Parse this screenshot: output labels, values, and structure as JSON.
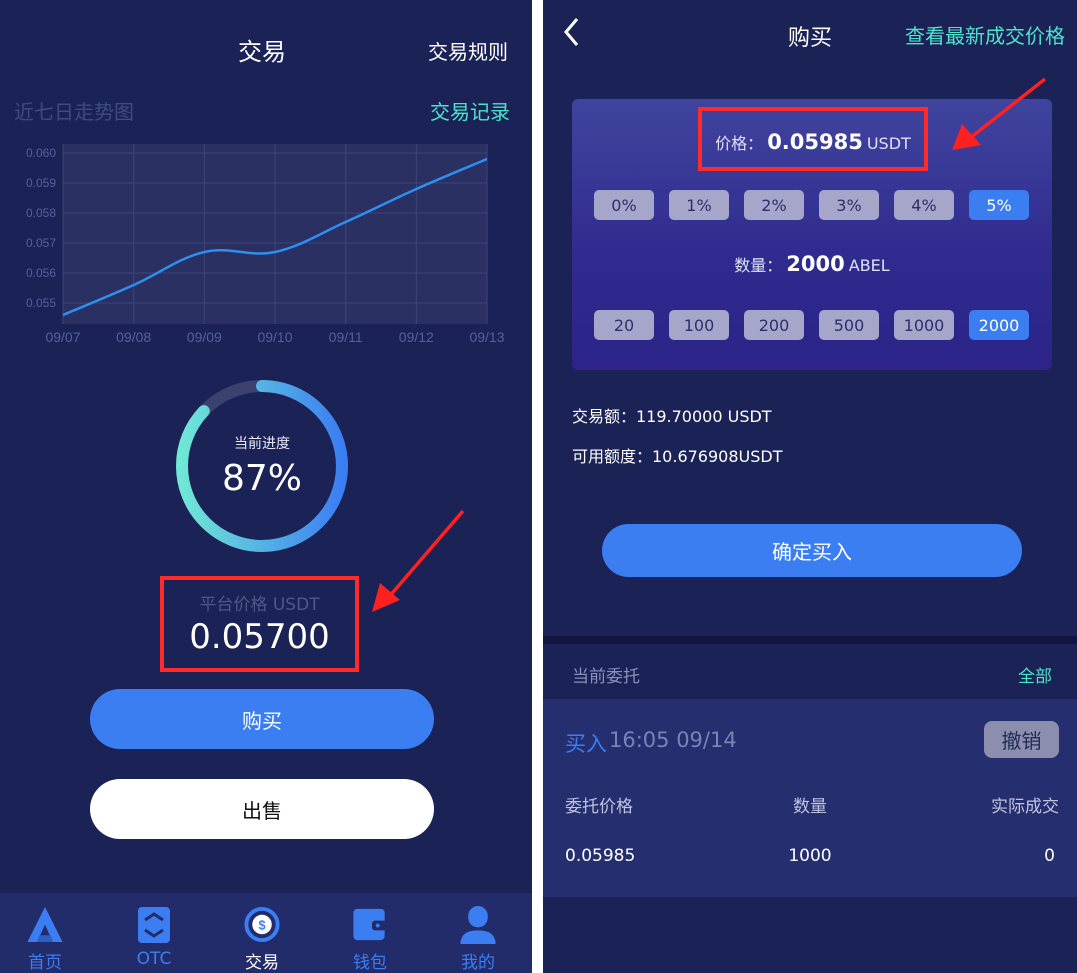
{
  "left": {
    "header": {
      "title": "交易",
      "rules_link": "交易规则"
    },
    "chart_section": {
      "title": "近七日走势图",
      "records_link": "交易记录"
    },
    "chart_data": {
      "type": "line",
      "categories": [
        "09/07",
        "09/08",
        "09/09",
        "09/10",
        "09/11",
        "09/12",
        "09/13"
      ],
      "series": [
        {
          "values": [
            0.0546,
            0.0556,
            0.0567,
            0.0567,
            0.0577,
            0.0588,
            0.0598
          ]
        }
      ],
      "y_ticks": [
        "0.060",
        "0.059",
        "0.058",
        "0.057",
        "0.056",
        "0.055"
      ],
      "ylim": [
        0.0543,
        0.0603
      ],
      "grid": true,
      "line_color": "#2e8ff0"
    },
    "progress": {
      "label": "当前进度",
      "value_text": "87%",
      "value": 0.87
    },
    "platform_price": {
      "label": "平台价格 USDT",
      "value": "0.05700"
    },
    "buttons": {
      "buy": "购买",
      "sell": "出售"
    },
    "tabbar": {
      "items": [
        {
          "label": "首页",
          "icon": "home-icon"
        },
        {
          "label": "OTC",
          "icon": "otc-exchange-icon"
        },
        {
          "label": "交易",
          "icon": "trade-coin-icon",
          "active": true
        },
        {
          "label": "钱包",
          "icon": "wallet-icon"
        },
        {
          "label": "我的",
          "icon": "user-icon"
        }
      ]
    }
  },
  "right": {
    "header": {
      "back_icon": "chevron-left-icon",
      "title": "购买",
      "latest_price_link": "查看最新成交价格"
    },
    "price": {
      "label": "价格：",
      "value": "0.05985",
      "unit": "USDT"
    },
    "percent_chips": [
      "0%",
      "1%",
      "2%",
      "3%",
      "4%",
      "5%"
    ],
    "percent_selected": "5%",
    "quantity": {
      "label": "数量：",
      "value": "2000",
      "unit": "ABEL"
    },
    "quantity_chips": [
      "20",
      "100",
      "200",
      "500",
      "1000",
      "2000"
    ],
    "quantity_selected": "2000",
    "trade_amount": "交易额：119.70000 USDT",
    "available": "可用额度：10.676908USDT",
    "confirm_button": "确定买入",
    "orders": {
      "title": "当前委托",
      "all_link": "全部",
      "items": [
        {
          "type": "买入",
          "time": "16:05 09/14",
          "cancel": "撤销",
          "headers": [
            "委托价格",
            "数量",
            "实际成交"
          ],
          "values": [
            "0.05985",
            "1000",
            "0"
          ]
        }
      ]
    }
  },
  "colors": {
    "background": "#1b2256",
    "accent": "#3a7ef2",
    "teal": "#4ee3cb",
    "highlight": "#ff2a2a"
  }
}
